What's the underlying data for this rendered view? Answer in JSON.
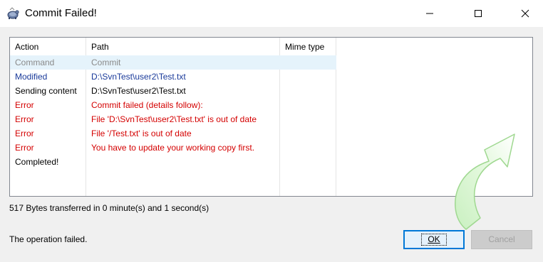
{
  "window": {
    "title": "Commit Failed!",
    "icon": "tortoise-svn-icon"
  },
  "list": {
    "headers": [
      "Action",
      "Path",
      "Mime type"
    ],
    "rows": [
      {
        "action": "Command",
        "path": "Commit",
        "mime": "",
        "color": "#8a8a8a",
        "selected": true
      },
      {
        "action": "Modified",
        "path": "D:\\SvnTest\\user2\\Test.txt",
        "mime": "",
        "color": "#1a3a9a"
      },
      {
        "action": "Sending content",
        "path": "D:\\SvnTest\\user2\\Test.txt",
        "mime": "",
        "color": "#000000"
      },
      {
        "action": "Error",
        "path": "Commit failed (details follow):",
        "mime": "",
        "color": "#d40000"
      },
      {
        "action": "Error",
        "path": "File 'D:\\SvnTest\\user2\\Test.txt' is out of date",
        "mime": "",
        "color": "#d40000"
      },
      {
        "action": "Error",
        "path": "File '/Test.txt' is out of date",
        "mime": "",
        "color": "#d40000"
      },
      {
        "action": "Error",
        "path": "You have to update your working copy first.",
        "mime": "",
        "color": "#d40000"
      },
      {
        "action": "Completed!",
        "path": "",
        "mime": "",
        "color": "#000000"
      }
    ]
  },
  "status": {
    "transfer": "517 Bytes transferred in 0 minute(s) and 1 second(s)",
    "result": "The operation failed."
  },
  "buttons": {
    "ok": "OK",
    "cancel": "Cancel"
  }
}
